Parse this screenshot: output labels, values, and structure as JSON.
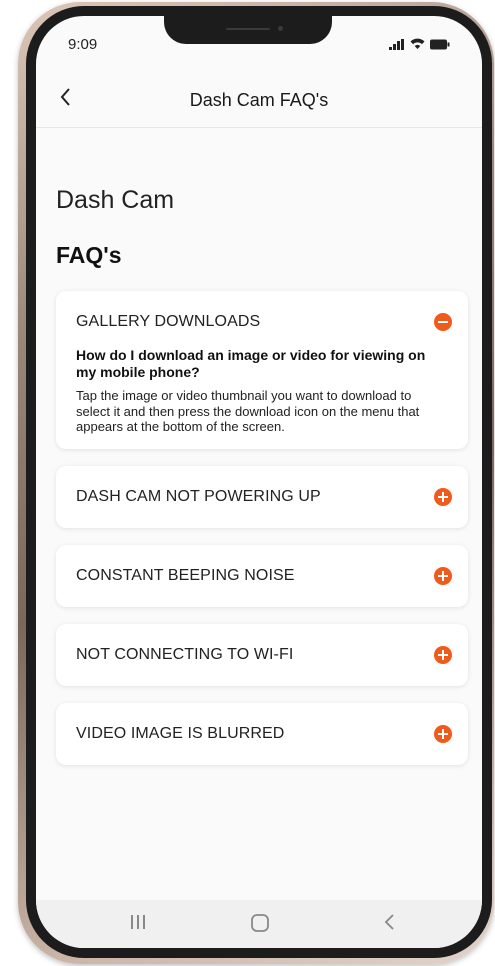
{
  "status_bar": {
    "time": "9:09"
  },
  "header": {
    "title": "Dash Cam FAQ's",
    "back_icon": "chevron-left-icon"
  },
  "page": {
    "section_title": "Dash Cam",
    "faq_title": "FAQ's"
  },
  "faqs": [
    {
      "label": "GALLERY DOWNLOADS",
      "expanded": true,
      "question": "How do I download an image or video for viewing on my mobile phone?",
      "answer": "Tap the image or video thumbnail you want to download to select it and then press the download icon on the menu that appears at the bottom of the screen."
    },
    {
      "label": "DASH CAM NOT POWERING UP",
      "expanded": false
    },
    {
      "label": "CONSTANT BEEPING NOISE",
      "expanded": false
    },
    {
      "label": "NOT CONNECTING TO WI-FI",
      "expanded": false
    },
    {
      "label": "VIDEO IMAGE IS BLURRED",
      "expanded": false
    }
  ],
  "colors": {
    "accent": "#f05a1a",
    "text": "#222222",
    "background": "#fafafa"
  },
  "nav_bar": {
    "icons": [
      "recent-apps-icon",
      "home-icon",
      "back-icon"
    ]
  }
}
